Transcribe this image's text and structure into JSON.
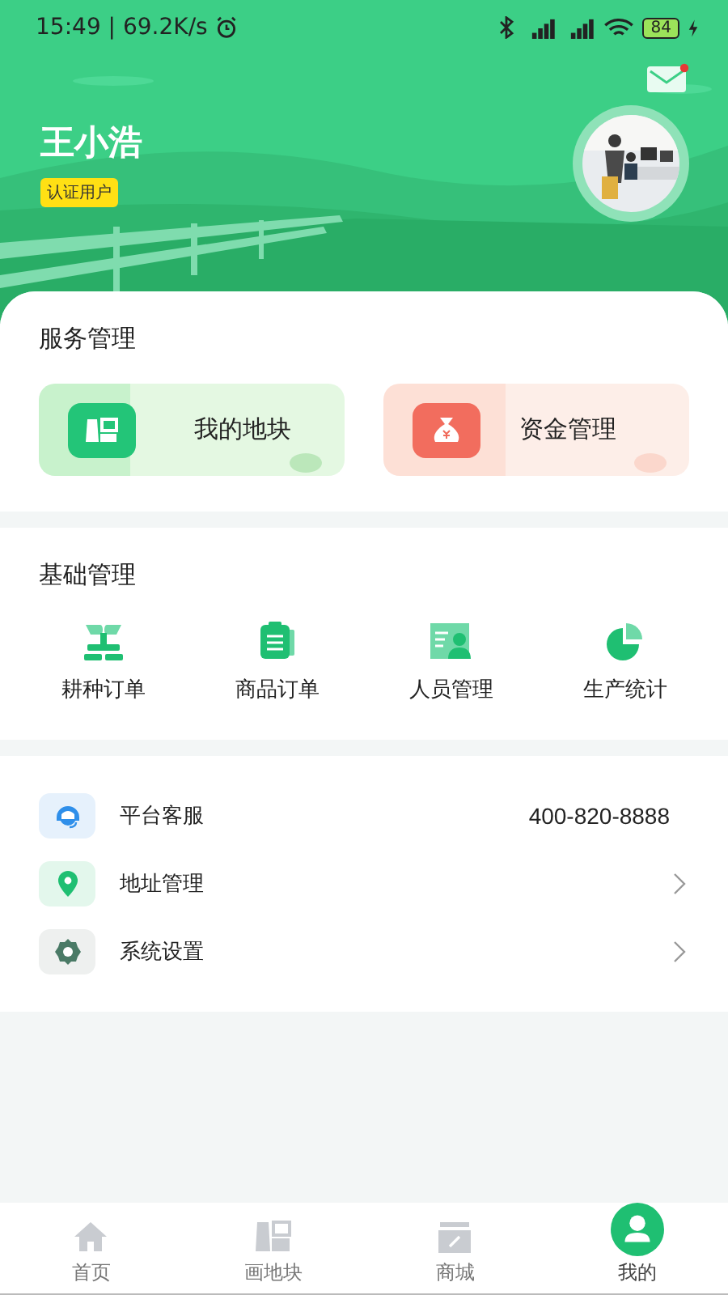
{
  "status_bar": {
    "time_speed": "15:49 | 69.2K/s",
    "battery": "84"
  },
  "header": {
    "mail_unread": true,
    "user_name": "王小浩",
    "badge": "认证用户"
  },
  "service": {
    "title": "服务管理",
    "cards": [
      {
        "label": "我的地块",
        "kind": "plot"
      },
      {
        "label": "资金管理",
        "kind": "money"
      }
    ]
  },
  "basic": {
    "title": "基础管理",
    "items": [
      {
        "label": "耕种订单",
        "kind": "sprout"
      },
      {
        "label": "商品订单",
        "kind": "clipboard"
      },
      {
        "label": "人员管理",
        "kind": "person"
      },
      {
        "label": "生产统计",
        "kind": "pie"
      }
    ]
  },
  "menu": [
    {
      "label": "平台客服",
      "kind": "support",
      "value": "400-820-8888",
      "chevron": false
    },
    {
      "label": "地址管理",
      "kind": "location",
      "chevron": true
    },
    {
      "label": "系统设置",
      "kind": "settings",
      "chevron": true
    }
  ],
  "tabs": [
    {
      "label": "首页",
      "kind": "home",
      "selected": false
    },
    {
      "label": "画地块",
      "kind": "plot",
      "selected": false
    },
    {
      "label": "商城",
      "kind": "shop",
      "selected": false
    },
    {
      "label": "我的",
      "kind": "me",
      "selected": true
    }
  ]
}
